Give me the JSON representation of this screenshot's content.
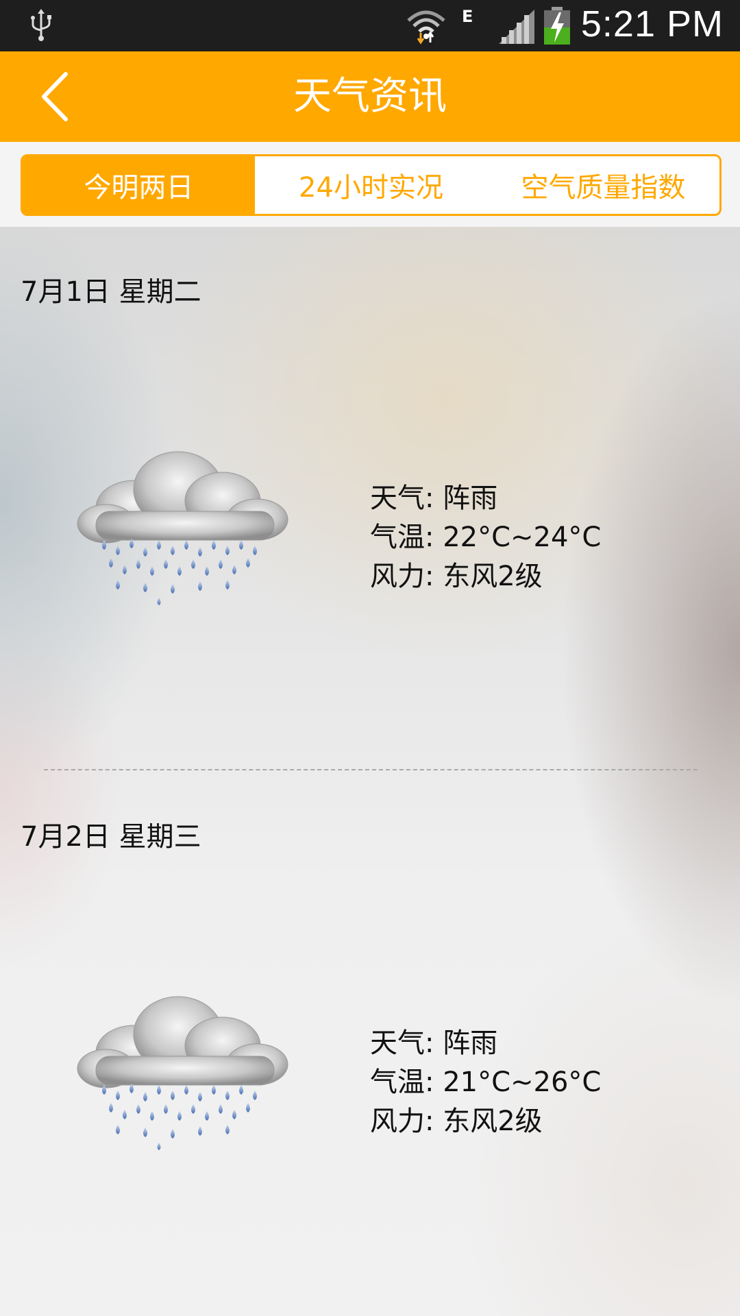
{
  "status_bar": {
    "time": "5:21 PM",
    "network_type": "E",
    "icons": [
      "usb-icon",
      "wifi-icon",
      "signal-icon",
      "battery-charging-icon"
    ]
  },
  "header": {
    "title": "天气资讯",
    "back_icon": "chevron-left-icon",
    "color": "#ffa800"
  },
  "tabs": [
    {
      "label": "今明两日",
      "active": true
    },
    {
      "label": "24小时实况",
      "active": false
    },
    {
      "label": "空气质量指数",
      "active": false
    }
  ],
  "days": [
    {
      "date": "7月1日 星期二",
      "icon": "rain-shower-cloud-icon",
      "weather": "天气: 阵雨",
      "temperature": "气温: 22°C~24°C",
      "wind": "风力: 东风2级"
    },
    {
      "date": "7月2日 星期三",
      "icon": "rain-shower-cloud-icon",
      "weather": "天气: 阵雨",
      "temperature": "气温: 21°C~26°C",
      "wind": "风力: 东风2级"
    }
  ]
}
